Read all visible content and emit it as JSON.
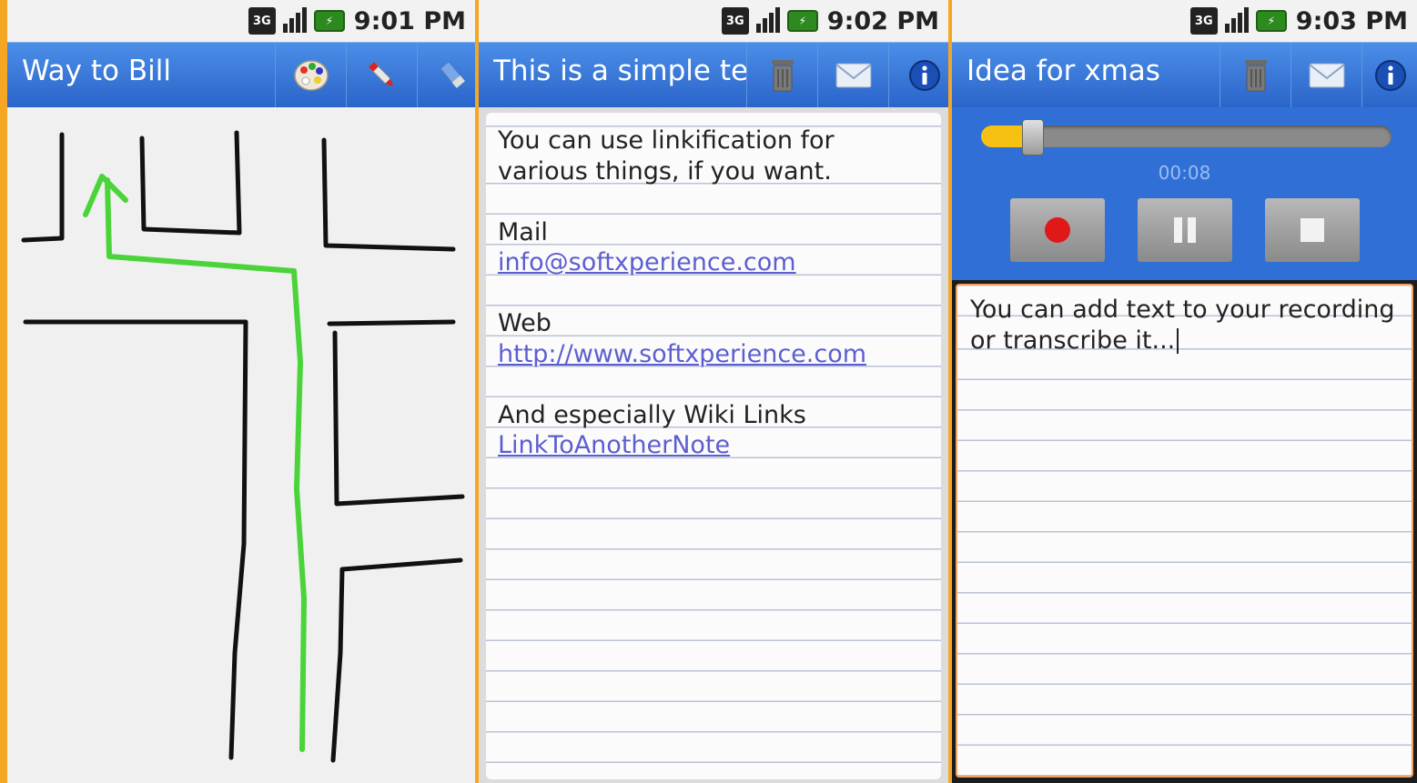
{
  "screens": [
    {
      "status": {
        "time": "9:01 PM",
        "network": "3G"
      },
      "title": "Way to Bill",
      "toolbar": [
        {
          "icon": "palette-icon"
        },
        {
          "icon": "pen-icon"
        },
        {
          "icon": "eraser-icon"
        }
      ]
    },
    {
      "status": {
        "time": "9:02 PM",
        "network": "3G"
      },
      "title": "This is a simple te",
      "toolbar": [
        {
          "icon": "trash-icon"
        },
        {
          "icon": "envelope-icon"
        },
        {
          "icon": "info-icon"
        }
      ],
      "note": {
        "intro": "You can use linkification for various things, if you want.",
        "mail_label": "Mail",
        "mail_link": "info@softxperience.com",
        "web_label": "Web",
        "web_link": "http://www.softxperience.com",
        "wiki_label": "And especially Wiki Links",
        "wiki_link": "LinkToAnotherNote"
      }
    },
    {
      "status": {
        "time": "9:03 PM",
        "network": "3G"
      },
      "title": "Idea for xmas",
      "toolbar": [
        {
          "icon": "trash-icon"
        },
        {
          "icon": "envelope-icon"
        },
        {
          "icon": "info-icon"
        }
      ],
      "recorder": {
        "elapsed": "00:08",
        "progress": 0.1,
        "buttons": [
          "record-icon",
          "pause-icon",
          "stop-icon"
        ]
      },
      "text": "You can add text to your recording or transcribe it..."
    }
  ],
  "colors": {
    "accent": "#2a64c9",
    "frame": "#f5a623",
    "route": "#4ad43a",
    "link": "#5c5ed0"
  }
}
